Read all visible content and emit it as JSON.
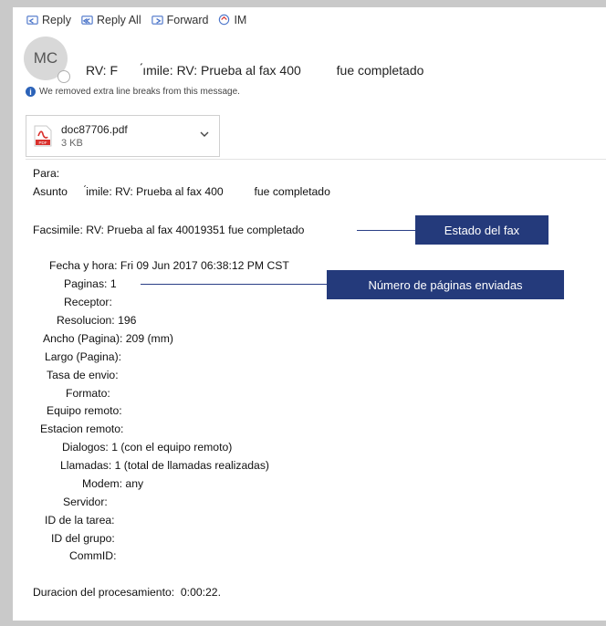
{
  "toolbar": {
    "reply": "Reply",
    "reply_all": "Reply All",
    "forward": "Forward",
    "im": "IM"
  },
  "header": {
    "avatar_initials": "MC",
    "subject": "RV: F       ́ımile: RV: Prueba al fax 400          fue completado",
    "notice": "We removed extra line breaks from this message."
  },
  "attachment": {
    "filename": "doc87706.pdf",
    "size": "3 KB",
    "icon_label": "PDF"
  },
  "message": {
    "para": "Para:",
    "asunto": "Asunto      ́imile: RV: Prueba al fax 400          fue completado",
    "facsimile": "Facsimile: RV: Prueba al fax 40019351 fue completado",
    "fields": [
      "Fecha y hora: Fri 09 Jun 2017 06:38:12 PM CST",
      "Paginas: 1",
      "Receptor:",
      "Resolucion: 196",
      "Ancho (Pagina): 209 (mm)",
      "Largo (Pagina):",
      "Tasa de envio:",
      "Formato:",
      "Equipo remoto:",
      "Estacion remoto:",
      "Dialogos: 1 (con el equipo remoto)",
      "Llamadas: 1 (total de llamadas realizadas)",
      "Modem: any",
      "Servidor:",
      "ID de la tarea:",
      "ID del grupo:",
      "CommID:"
    ],
    "duration": "Duracion del procesamiento:  0:00:22."
  },
  "callouts": {
    "fax_status": "Estado del fax",
    "pages_sent": "Número de páginas enviadas"
  },
  "colors": {
    "callout_bg": "#243a7b",
    "info_icon": "#2b62b8",
    "pdf_red": "#d9302c"
  }
}
